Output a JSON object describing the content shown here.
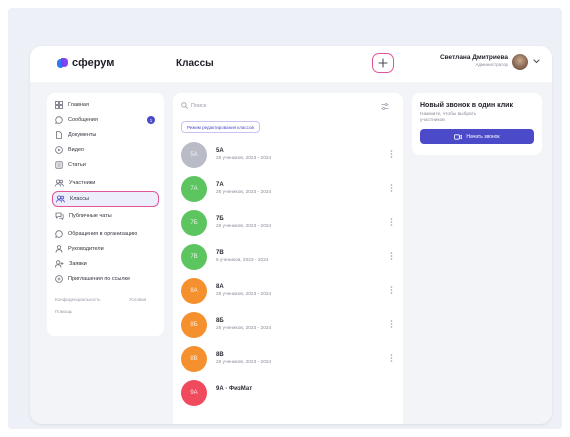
{
  "header": {
    "logo_text": "сферум",
    "page_title": "Классы",
    "user_name": "Светлана Дмитриева",
    "user_role": "Администратор"
  },
  "sidebar": {
    "items": [
      {
        "label": "Главная",
        "icon": "grid-icon"
      },
      {
        "label": "Сообщения",
        "icon": "chat-icon",
        "badge": "1"
      },
      {
        "label": "Документы",
        "icon": "document-icon"
      },
      {
        "label": "Видео",
        "icon": "video-icon"
      },
      {
        "label": "Статьи",
        "icon": "article-icon"
      },
      {
        "label": "Участники",
        "icon": "people-icon"
      },
      {
        "label": "Классы",
        "icon": "classes-icon",
        "active": true
      },
      {
        "label": "Публичные чаты",
        "icon": "public-chat-icon"
      },
      {
        "label": "Обращения в организацию",
        "icon": "request-icon"
      },
      {
        "label": "Руководители",
        "icon": "person-icon"
      },
      {
        "label": "Заявки",
        "icon": "add-person-icon"
      },
      {
        "label": "Приглашения по ссылке",
        "icon": "link-icon"
      }
    ],
    "footer": {
      "privacy": "Конфиденциальность",
      "terms": "Условия",
      "help": "Помощь"
    }
  },
  "list": {
    "search_placeholder": "Поиск",
    "mode_button": "Режим редактирования классов",
    "rows": [
      {
        "avatar": "5А",
        "name": "5А",
        "sub": "25 учеников, 2023 - 2024",
        "color": "#b9bcc6"
      },
      {
        "avatar": "7А",
        "name": "7А",
        "sub": "25 учеников, 2023 - 2024",
        "color": "#5cc55f"
      },
      {
        "avatar": "7Б",
        "name": "7Б",
        "sub": "25 учеников, 2023 - 2024",
        "color": "#5cc55f"
      },
      {
        "avatar": "7В",
        "name": "7В",
        "sub": "6 учеников, 2023 - 2024",
        "color": "#5cc55f"
      },
      {
        "avatar": "8А",
        "name": "8А",
        "sub": "25 учеников, 2023 - 2024",
        "color": "#f5902e"
      },
      {
        "avatar": "8Б",
        "name": "8Б",
        "sub": "25 учеников, 2023 - 2024",
        "color": "#f5902e"
      },
      {
        "avatar": "8В",
        "name": "8В",
        "sub": "25 учеников, 2023 - 2024",
        "color": "#f5902e"
      },
      {
        "avatar": "9А",
        "name": "9А · ФизМат",
        "sub": "",
        "color": "#ef4b5c"
      }
    ]
  },
  "call_card": {
    "title": "Новый звонок в один клик",
    "description": "Нажмите, чтобы выбрать участников",
    "button": "Начать звонок"
  },
  "colors": {
    "accent": "#4b4ac8",
    "highlight": "#e0559a"
  }
}
